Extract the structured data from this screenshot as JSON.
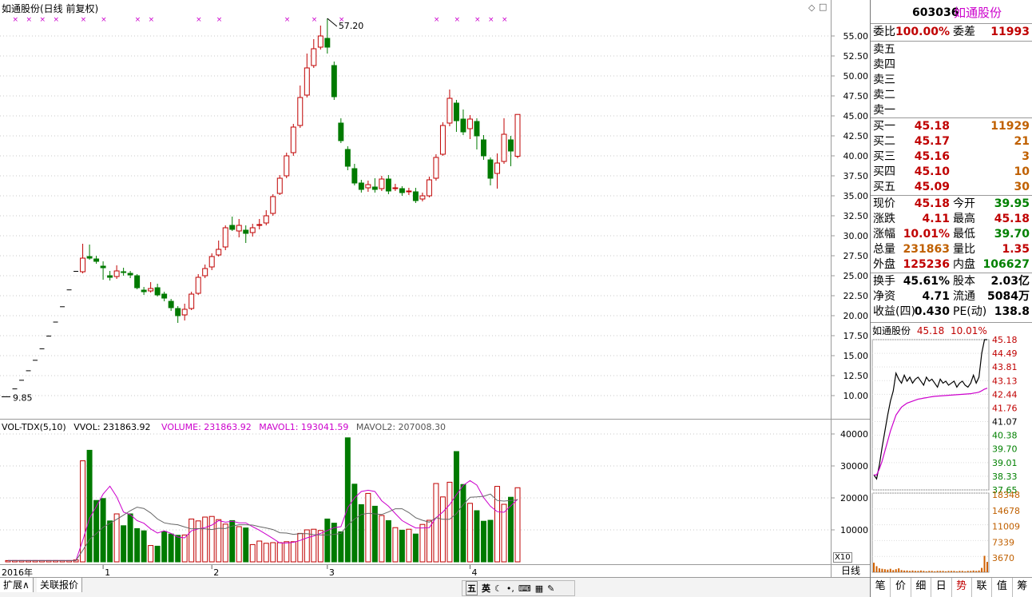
{
  "window": {
    "chart_title": "如通股份(日线 前复权)",
    "period": "日线"
  },
  "main_chart": {
    "price_min": 7.5,
    "price_max": 57.5,
    "y_ticks": [
      "55.00",
      "52.50",
      "50.00",
      "47.50",
      "45.00",
      "42.50",
      "40.00",
      "37.50",
      "35.00",
      "32.50",
      "30.00",
      "27.50",
      "25.00",
      "22.50",
      "20.00",
      "17.50",
      "15.00",
      "12.50",
      "10.00"
    ],
    "high_label": "57.20",
    "low_label": "9.85",
    "colors": {
      "up": "#c00000",
      "down": "#007a00",
      "flat": "#000000"
    },
    "candles": [
      [
        9.85,
        9.85,
        9.85,
        9.85
      ],
      [
        10.84,
        10.84,
        10.84,
        10.84
      ],
      [
        11.92,
        11.92,
        11.92,
        11.92
      ],
      [
        13.11,
        13.11,
        13.11,
        13.11
      ],
      [
        14.42,
        14.42,
        14.42,
        14.42
      ],
      [
        15.86,
        15.86,
        15.86,
        15.86
      ],
      [
        17.45,
        17.45,
        17.45,
        17.45
      ],
      [
        19.2,
        19.2,
        19.2,
        19.2
      ],
      [
        21.12,
        21.12,
        21.12,
        21.12
      ],
      [
        23.23,
        23.23,
        23.23,
        23.23
      ],
      [
        25.55,
        25.55,
        25.55,
        25.55
      ],
      [
        25.5,
        27.2,
        29.0,
        25.3
      ],
      [
        27.4,
        27.2,
        28.9,
        27.0
      ],
      [
        27.1,
        26.8,
        27.5,
        26.5
      ],
      [
        26.2,
        26.0,
        26.8,
        24.5
      ],
      [
        25.0,
        24.8,
        25.6,
        24.4
      ],
      [
        24.9,
        25.6,
        26.3,
        24.6
      ],
      [
        25.5,
        25.4,
        26.0,
        25.0
      ],
      [
        25.3,
        25.1,
        25.6,
        24.7
      ],
      [
        25.0,
        23.5,
        25.2,
        23.3
      ],
      [
        23.2,
        23.0,
        23.6,
        22.6
      ],
      [
        23.1,
        23.4,
        24.2,
        22.9
      ],
      [
        23.5,
        22.6,
        24.0,
        22.4
      ],
      [
        22.7,
        22.2,
        23.0,
        21.8
      ],
      [
        21.8,
        21.0,
        22.1,
        20.6
      ],
      [
        20.9,
        20.0,
        21.2,
        19.1
      ],
      [
        20.1,
        20.8,
        21.5,
        19.4
      ],
      [
        20.9,
        22.7,
        23.0,
        20.7
      ],
      [
        22.8,
        24.8,
        25.2,
        22.6
      ],
      [
        25.0,
        25.9,
        26.4,
        24.7
      ],
      [
        26.1,
        27.4,
        27.8,
        25.7
      ],
      [
        27.6,
        28.3,
        29.4,
        27.4
      ],
      [
        28.6,
        31.0,
        31.3,
        28.2
      ],
      [
        31.3,
        30.8,
        32.4,
        30.6
      ],
      [
        30.6,
        31.3,
        32.1,
        29.8
      ],
      [
        30.7,
        30.3,
        31.3,
        29.1
      ],
      [
        30.4,
        31.0,
        31.5,
        29.9
      ],
      [
        31.3,
        31.4,
        32.1,
        30.8
      ],
      [
        31.6,
        32.5,
        33.2,
        31.3
      ],
      [
        32.8,
        34.9,
        35.2,
        32.5
      ],
      [
        35.3,
        37.2,
        37.6,
        35.1
      ],
      [
        37.5,
        40.0,
        40.4,
        37.2
      ],
      [
        40.4,
        43.6,
        44.0,
        40.0
      ],
      [
        43.8,
        47.3,
        48.8,
        43.5
      ],
      [
        47.6,
        51.0,
        52.8,
        47.3
      ],
      [
        51.3,
        53.4,
        54.6,
        51.0
      ],
      [
        53.6,
        55.0,
        56.3,
        53.3
      ],
      [
        54.7,
        53.6,
        57.2,
        52.8
      ],
      [
        51.3,
        47.4,
        51.8,
        47.0
      ],
      [
        44.1,
        41.9,
        44.7,
        41.6
      ],
      [
        40.8,
        38.7,
        41.2,
        38.2
      ],
      [
        38.4,
        36.6,
        39.0,
        36.3
      ],
      [
        36.6,
        35.8,
        37.0,
        35.4
      ],
      [
        36.0,
        36.4,
        36.9,
        35.5
      ],
      [
        36.1,
        35.8,
        37.2,
        35.4
      ],
      [
        35.9,
        37.1,
        37.5,
        35.6
      ],
      [
        37.1,
        35.6,
        37.6,
        35.2
      ],
      [
        35.9,
        36.0,
        36.5,
        35.6
      ],
      [
        35.9,
        35.4,
        36.2,
        35.0
      ],
      [
        35.5,
        35.6,
        36.0,
        35.1
      ],
      [
        35.5,
        34.4,
        36.0,
        34.1
      ],
      [
        34.6,
        35.0,
        35.4,
        34.3
      ],
      [
        35.0,
        37.0,
        37.4,
        34.8
      ],
      [
        37.2,
        39.8,
        40.2,
        36.9
      ],
      [
        40.2,
        43.8,
        44.2,
        40.0
      ],
      [
        44.1,
        47.2,
        48.3,
        43.7
      ],
      [
        46.6,
        44.4,
        47.0,
        43.0
      ],
      [
        44.6,
        43.0,
        45.8,
        42.6
      ],
      [
        43.4,
        44.6,
        45.1,
        42.1
      ],
      [
        44.3,
        42.5,
        44.7,
        40.8
      ],
      [
        42.0,
        40.0,
        42.6,
        39.5
      ],
      [
        39.5,
        37.2,
        39.8,
        36.3
      ],
      [
        37.8,
        39.1,
        40.3,
        35.9
      ],
      [
        39.3,
        42.7,
        44.7,
        39.0
      ],
      [
        42.0,
        40.6,
        42.5,
        38.7
      ],
      [
        39.95,
        45.18,
        45.18,
        39.7
      ]
    ],
    "flag_indexes": [
      1,
      3,
      5,
      7,
      11,
      14,
      19,
      21,
      28,
      31,
      41,
      45,
      49,
      63,
      66,
      69,
      71,
      73
    ]
  },
  "volume_chart": {
    "indicator": "VOL-TDX(5,10)",
    "vvol_label": "VVOL: 231863.92",
    "volume_label": "VOLUME: 231863.92",
    "mavol1_label": "MAVOL1: 193041.59",
    "mavol2_label": "MAVOL2: 207008.30",
    "vol_max": 40000,
    "y_ticks": [
      "40000",
      "30000",
      "20000",
      "10000"
    ],
    "scale_label": "X10",
    "volumes": [
      400,
      400,
      400,
      400,
      400,
      400,
      400,
      400,
      400,
      400,
      600,
      31600,
      34900,
      19200,
      19800,
      12800,
      15000,
      11300,
      15000,
      10400,
      9700,
      5100,
      4900,
      9500,
      8700,
      8300,
      8400,
      13400,
      12800,
      14000,
      14200,
      13200,
      11800,
      12900,
      11000,
      10600,
      5400,
      6500,
      5800,
      6000,
      6000,
      6300,
      6300,
      8900,
      10000,
      10200,
      9800,
      13400,
      12100,
      9400,
      38800,
      24300,
      17900,
      21400,
      17400,
      14500,
      12900,
      10700,
      9900,
      10200,
      8700,
      11700,
      13000,
      24500,
      20300,
      24900,
      34500,
      24200,
      18300,
      16000,
      12700,
      13000,
      23600,
      18000,
      20200,
      23186
    ],
    "mavol1": [
      400,
      400,
      400,
      400,
      400,
      400,
      400,
      400,
      400,
      400,
      440,
      6680,
      13640,
      17300,
      21200,
      23660,
      20340,
      15580,
      14780,
      12900,
      12080,
      10300,
      9020,
      9720,
      8900,
      7740,
      7500,
      9700,
      10300,
      10700,
      11500,
      12900,
      12400,
      12700,
      12200,
      12200,
      11000,
      9900,
      8600,
      7300,
      5900,
      5900,
      6100,
      6700,
      7500,
      8100,
      8900,
      9800,
      10700,
      11000,
      16900,
      20000,
      22000,
      22400,
      22000,
      19100,
      17400,
      15100,
      12900,
      11700,
      10600,
      10600,
      10700,
      13800,
      15600,
      17900,
      21000,
      23900,
      25400,
      24000,
      20100,
      17400,
      15700,
      15500,
      17500,
      19600
    ],
    "mavol2": [
      400,
      400,
      400,
      400,
      400,
      400,
      400,
      400,
      400,
      400,
      420,
      3560,
      7020,
      8850,
      10800,
      12060,
      13300,
      14600,
      16000,
      17100,
      16700,
      15300,
      13400,
      12200,
      11800,
      11600,
      10900,
      10300,
      10400,
      10300,
      10100,
      10500,
      10400,
      11200,
      11600,
      11600,
      11500,
      11000,
      10600,
      10100,
      9100,
      9000,
      8600,
      8800,
      8800,
      8500,
      8400,
      8400,
      8600,
      8900,
      11400,
      13400,
      14800,
      15200,
      15000,
      14800,
      15600,
      16600,
      16600,
      15400,
      13800,
      13000,
      12400,
      13800,
      13300,
      13300,
      15100,
      17900,
      20200,
      20300,
      20500,
      21200,
      19200,
      19000,
      19200,
      19400
    ]
  },
  "x_axis": {
    "labels": [
      {
        "text": "2016年",
        "index": 0
      },
      {
        "text": "1",
        "index": 14
      },
      {
        "text": "2",
        "index": 30
      },
      {
        "text": "3",
        "index": 47
      },
      {
        "text": "4",
        "index": 68
      }
    ]
  },
  "bottom_tabs": [
    "扩展∧",
    "关联报价"
  ],
  "ime": {
    "a": "五",
    "b": "英"
  },
  "quote": {
    "code": "603036",
    "name": "如通股份",
    "weibi_label": "委比",
    "weibi": "100.00%",
    "weicha_label": "委差",
    "weicha": "11993",
    "sell": [
      {
        "label": "卖五",
        "price": "",
        "vol": ""
      },
      {
        "label": "卖四",
        "price": "",
        "vol": ""
      },
      {
        "label": "卖三",
        "price": "",
        "vol": ""
      },
      {
        "label": "卖二",
        "price": "",
        "vol": ""
      },
      {
        "label": "卖一",
        "price": "",
        "vol": ""
      }
    ],
    "buy": [
      {
        "label": "买一",
        "price": "45.18",
        "vol": "11929"
      },
      {
        "label": "买二",
        "price": "45.17",
        "vol": "21"
      },
      {
        "label": "买三",
        "price": "45.16",
        "vol": "3"
      },
      {
        "label": "买四",
        "price": "45.10",
        "vol": "10"
      },
      {
        "label": "买五",
        "price": "45.09",
        "vol": "30"
      }
    ],
    "stats": [
      {
        "k1": "现价",
        "v1": "45.18",
        "c1": "red",
        "k2": "今开",
        "v2": "39.95",
        "c2": "green"
      },
      {
        "k1": "涨跌",
        "v1": "4.11",
        "c1": "red",
        "k2": "最高",
        "v2": "45.18",
        "c2": "red"
      },
      {
        "k1": "涨幅",
        "v1": "10.01%",
        "c1": "red",
        "k2": "最低",
        "v2": "39.70",
        "c2": "green"
      },
      {
        "k1": "总量",
        "v1": "231863",
        "c1": "orange",
        "k2": "量比",
        "v2": "1.35",
        "c2": "red"
      },
      {
        "k1": "外盘",
        "v1": "125236",
        "c1": "red",
        "k2": "内盘",
        "v2": "106627",
        "c2": "green"
      }
    ],
    "info": [
      {
        "k1": "换手",
        "v1": "45.61%",
        "k2": "股本",
        "v2": "2.03亿"
      },
      {
        "k1": "净资",
        "v1": "4.71",
        "k2": "流通",
        "v2": "5084万"
      },
      {
        "k1": "收益(四)",
        "v1": "0.430",
        "k2": "PE(动)",
        "v2": "138.8"
      }
    ]
  },
  "intraday": {
    "title_name": "如通股份",
    "title_price": "45.18",
    "title_pct": "10.01%",
    "price_ticks": [
      "45.18",
      "44.49",
      "43.81",
      "43.13",
      "42.44",
      "41.76",
      "41.07",
      "40.38",
      "39.70",
      "39.01",
      "38.33",
      "37.65"
    ],
    "vol_ticks": [
      "18348",
      "14678",
      "11009",
      "7339",
      "3670"
    ],
    "price_max": 45.18,
    "price_min": 37.65,
    "price": [
      38.4,
      38.2,
      38.9,
      39.8,
      40.6,
      41.4,
      42.1,
      42.6,
      43.5,
      43.2,
      43.0,
      43.4,
      43.1,
      43.3,
      43.0,
      43.2,
      43.3,
      43.1,
      42.9,
      43.3,
      43.1,
      43.2,
      43.0,
      42.8,
      43.2,
      43.0,
      43.1,
      42.9,
      43.0,
      43.1,
      42.8,
      43.0,
      43.1,
      42.9,
      42.8,
      43.0,
      43.4,
      43.0,
      43.3,
      44.5,
      45.18,
      45.18
    ],
    "avg": [
      38.4,
      38.4,
      38.7,
      39.1,
      39.6,
      40.1,
      40.6,
      41.0,
      41.4,
      41.6,
      41.8,
      41.9,
      42.0,
      42.05,
      42.1,
      42.15,
      42.2,
      42.22,
      42.25,
      42.27,
      42.3,
      42.32,
      42.34,
      42.35,
      42.36,
      42.37,
      42.38,
      42.39,
      42.4,
      42.41,
      42.42,
      42.43,
      42.44,
      42.45,
      42.46,
      42.47,
      42.5,
      42.52,
      42.55,
      42.62,
      42.7,
      42.75
    ],
    "vols": [
      2200,
      1400,
      900,
      800,
      700,
      600,
      800,
      500,
      700,
      900,
      500,
      400,
      400,
      300,
      400,
      300,
      300,
      400,
      300,
      200,
      300,
      300,
      200,
      300,
      300,
      300,
      200,
      300,
      300,
      300,
      200,
      300,
      300,
      200,
      300,
      300,
      400,
      300,
      400,
      1000,
      3800,
      2400
    ],
    "vol_max": 18348
  },
  "side_tabs": [
    "笔",
    "价",
    "细",
    "日",
    "势",
    "联",
    "值",
    "筹"
  ],
  "side_active_tab": "势"
}
